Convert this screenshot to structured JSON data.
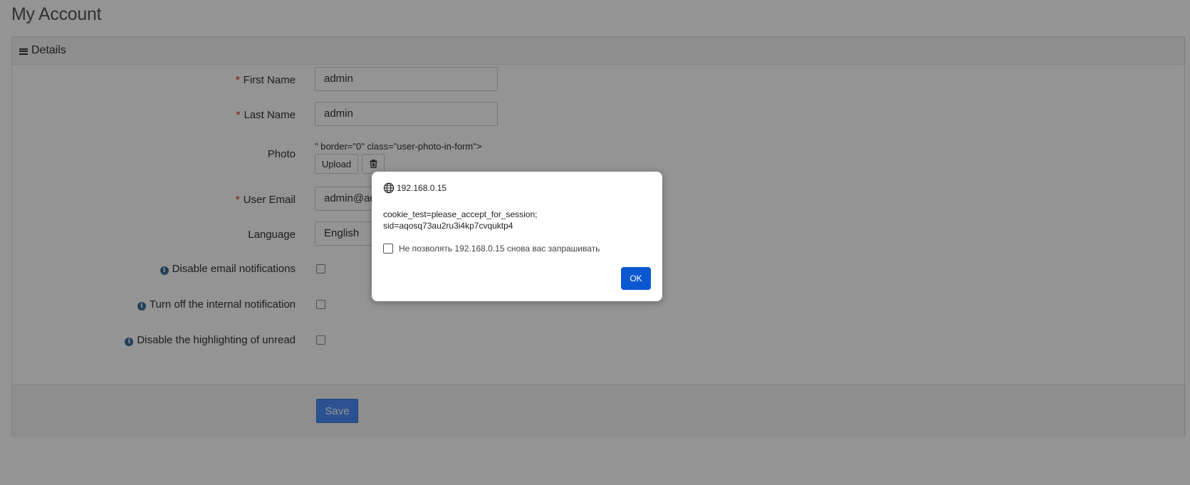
{
  "page": {
    "title": "My Account"
  },
  "portlet": {
    "title": "Details"
  },
  "form": {
    "first_name": {
      "label": "First Name",
      "value": "admin"
    },
    "last_name": {
      "label": "Last Name",
      "value": "admin"
    },
    "photo": {
      "label": "Photo",
      "broken_markup": "\" border=\"0\" class=\"user-photo-in-form\">",
      "upload_label": "Upload"
    },
    "user_email": {
      "label": "User Email",
      "value": "admin@ad"
    },
    "language": {
      "label": "Language",
      "value": "English"
    },
    "disable_email": {
      "label": "Disable email notifications"
    },
    "turn_off_internal": {
      "label": "Turn off the internal notification"
    },
    "disable_highlight": {
      "label": "Disable the highlighting of unread"
    },
    "required_mark": "*",
    "save_label": "Save"
  },
  "dialog": {
    "origin": "192.168.0.15",
    "message_line1": "cookie_test=please_accept_for_session;",
    "message_line2": "sid=aqosq73au2ru3i4kp7cvquktp4",
    "checkbox_label": "Не позволять 192.168.0.15 снова вас запрашивать",
    "ok_label": "OK"
  },
  "colors": {
    "primary_button": "#4b8df8",
    "dialog_ok": "#0b57d0",
    "required": "#e02222",
    "info_icon": "#3d6e9c"
  },
  "icons": {
    "portlet": "bars-icon",
    "info": "info-circle-icon",
    "delete": "trash-icon",
    "origin": "globe-icon"
  }
}
